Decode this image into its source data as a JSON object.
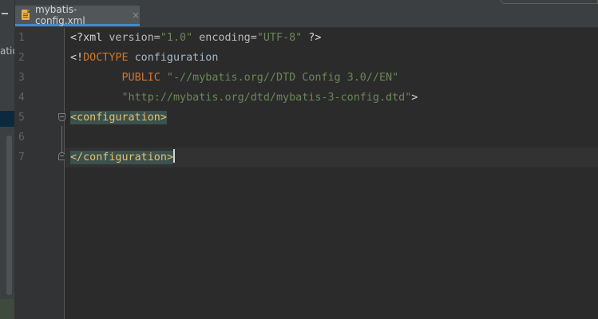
{
  "left_panel": {
    "truncated_label": "ation"
  },
  "tabs": [
    {
      "label": "mybatis-config.xml",
      "icon": "xml-file-icon",
      "close_glyph": "×"
    }
  ],
  "editor": {
    "line_numbers": [
      "1",
      "2",
      "3",
      "4",
      "5",
      "6",
      "7"
    ],
    "lines": [
      {
        "decl_open": "<?xml ",
        "attr1": "version=",
        "val1": "\"1.0\"",
        "attr2": " encoding=",
        "val2": "\"UTF-8\"",
        "decl_close": " ?>"
      },
      {
        "open": "<!",
        "keyword": "DOCTYPE",
        "rest": " configuration"
      },
      {
        "indent": "        ",
        "keyword": "PUBLIC",
        "value": " \"-//mybatis.org//DTD Config 3.0//EN\""
      },
      {
        "indent": "        ",
        "value": "\"http://mybatis.org/dtd/mybatis-3-config.dtd\"",
        "close": ">"
      },
      {
        "tag_open": "<",
        "tag": "configuration",
        "tag_close": ">"
      },
      {
        "text": ""
      },
      {
        "tag_open": "</",
        "tag": "configuration",
        "tag_close": ">"
      }
    ]
  },
  "colors": {
    "editor_bg": "#2b2b2b",
    "gutter_bg": "#313335",
    "tag": "#e8bf6a",
    "string": "#6a8759",
    "keyword": "#cc7832",
    "tab_underline": "#4a88c7",
    "tag_highlight_bg": "#3b514d"
  }
}
